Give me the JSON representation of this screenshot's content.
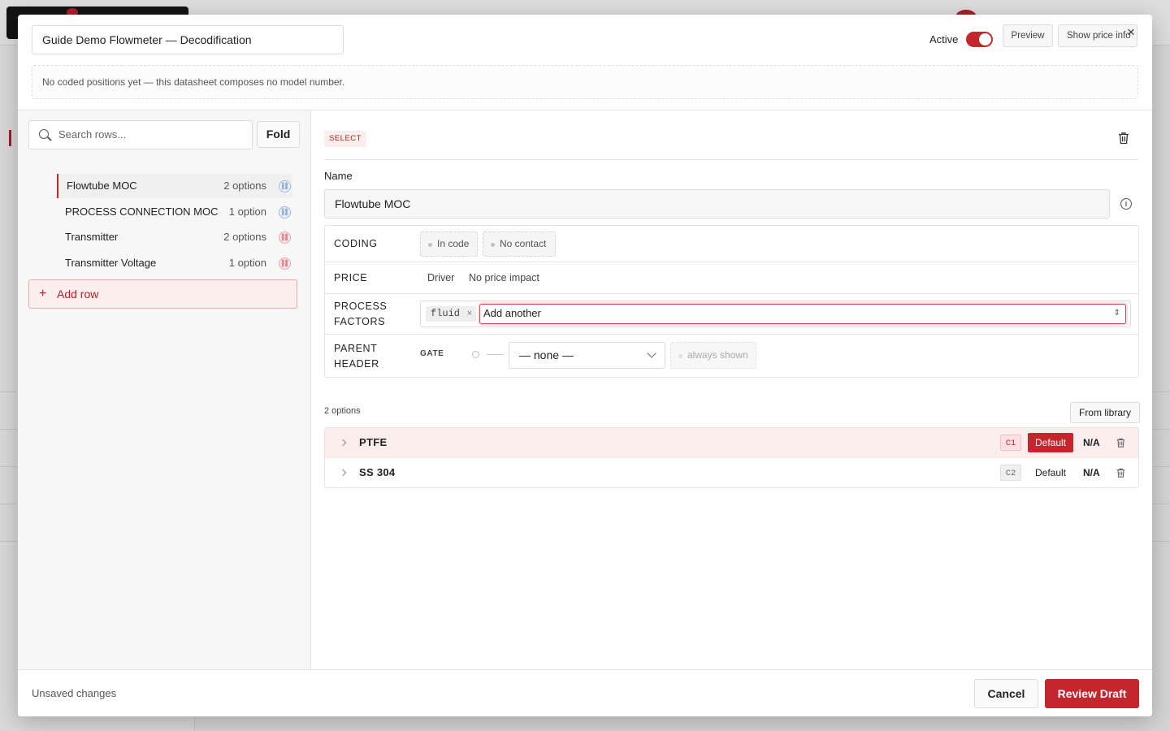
{
  "header": {
    "title": "Guide Demo Flowmeter — Decodification",
    "active_label": "Active",
    "active_on": true,
    "preview_label": "Preview",
    "show_price_label": "Show price info",
    "notice": "No coded positions yet — this datasheet composes no model number."
  },
  "sidebar": {
    "search_placeholder": "Search rows...",
    "fold_label": "Fold",
    "rows": [
      {
        "name": "Flowtube MOC",
        "count": "2 options",
        "icon": "link-icon",
        "state": "blue"
      },
      {
        "name": "PROCESS CONNECTION MOC",
        "count": "1 option",
        "icon": "link-icon",
        "state": "blue"
      },
      {
        "name": "Transmitter",
        "count": "2 options",
        "icon": "link-icon",
        "state": "red"
      },
      {
        "name": "Transmitter Voltage",
        "count": "1 option",
        "icon": "link-icon",
        "state": "red"
      }
    ],
    "add_row_label": "Add row"
  },
  "editor": {
    "type_tag": "SELECT",
    "name_label": "Name",
    "name_value": "Flowtube MOC",
    "coding_label": "CODING",
    "coding_chips": [
      "In code",
      "No contact"
    ],
    "price_label": "PRICE",
    "price_driver": "Driver",
    "price_impact": "No price impact",
    "process_factors_label_1": "PROCESS",
    "process_factors_label_2": "FACTORS",
    "process_factor_tag": "fluid",
    "add_another": "Add another",
    "parent_label_1": "PARENT",
    "parent_label_2": "HEADER",
    "gate_label": "GATE",
    "parent_select": "— none —",
    "always_shown": "always shown",
    "options_count": "2 options",
    "from_library": "From library",
    "options": [
      {
        "name": "PTFE",
        "code": "C1",
        "default_label": "Default",
        "is_default": true,
        "na": "N/A"
      },
      {
        "name": "SS 304",
        "code": "C2",
        "default_label": "Default",
        "is_default": false,
        "na": "N/A"
      }
    ]
  },
  "footer": {
    "status": "Unsaved changes",
    "cancel_label": "Cancel",
    "review_label": "Review Draft"
  },
  "colors": {
    "accent": "#c4262e",
    "accent_soft": "#fdeeee"
  }
}
